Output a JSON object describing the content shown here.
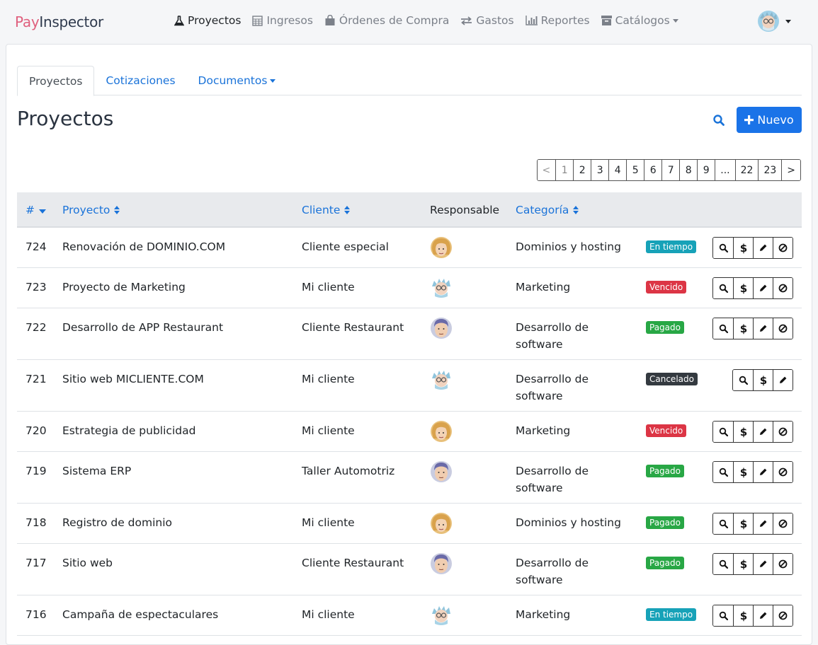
{
  "brand": {
    "part1": "Pay",
    "part2": "Inspector"
  },
  "nav": [
    {
      "label": "Proyectos",
      "icon": "flask-icon",
      "active": true
    },
    {
      "label": "Ingresos",
      "icon": "calculator-icon"
    },
    {
      "label": "Órdenes de Compra",
      "icon": "shopping-bag-icon"
    },
    {
      "label": "Gastos",
      "icon": "exchange-icon"
    },
    {
      "label": "Reportes",
      "icon": "bar-chart-icon"
    },
    {
      "label": "Catálogos",
      "icon": "archive-icon",
      "dropdown": true
    }
  ],
  "tabs": [
    {
      "label": "Proyectos",
      "active": true
    },
    {
      "label": "Cotizaciones"
    },
    {
      "label": "Documentos",
      "dropdown": true
    }
  ],
  "page": {
    "title": "Proyectos",
    "new_label": "Nuevo"
  },
  "pagination": [
    "<",
    "1",
    "2",
    "3",
    "4",
    "5",
    "6",
    "7",
    "8",
    "9",
    "...",
    "22",
    "23",
    ">"
  ],
  "columns": {
    "id": "#",
    "project": "Proyecto",
    "client": "Cliente",
    "responsible": "Responsable",
    "category": "Categoría"
  },
  "rows": [
    {
      "id": "724",
      "project": "Renovación de DOMINIO.COM",
      "client": "Cliente especial",
      "avatar": "blonde",
      "category": [
        "Dominios y hosting"
      ],
      "status": "En tiempo",
      "status_color": "#17a2b8",
      "cancel": true
    },
    {
      "id": "723",
      "project": "Proyecto de Marketing",
      "client": "Mi cliente",
      "avatar": "scientist",
      "category": [
        "Marketing"
      ],
      "status": "Vencido",
      "status_color": "#dc3545",
      "cancel": true
    },
    {
      "id": "722",
      "project": "Desarrollo de APP Restaurant",
      "client": "Cliente Restaurant",
      "avatar": "man",
      "category": [
        "Desarrollo de",
        "software"
      ],
      "status": "Pagado",
      "status_color": "#28a745",
      "cancel": true
    },
    {
      "id": "721",
      "project": "Sitio web MICLIENTE.COM",
      "client": "Mi cliente",
      "avatar": "scientist",
      "category": [
        "Desarrollo de",
        "software"
      ],
      "status": "Cancelado",
      "status_color": "#343a40",
      "cancel": false
    },
    {
      "id": "720",
      "project": "Estrategia de publicidad",
      "client": "Mi cliente",
      "avatar": "blonde",
      "category": [
        "Marketing"
      ],
      "status": "Vencido",
      "status_color": "#dc3545",
      "cancel": true
    },
    {
      "id": "719",
      "project": "Sistema ERP",
      "client": "Taller Automotriz",
      "avatar": "man",
      "category": [
        "Desarrollo de",
        "software"
      ],
      "status": "Pagado",
      "status_color": "#28a745",
      "cancel": true
    },
    {
      "id": "718",
      "project": "Registro de dominio",
      "client": "Mi cliente",
      "avatar": "blonde",
      "category": [
        "Dominios y hosting"
      ],
      "status": "Pagado",
      "status_color": "#28a745",
      "cancel": true
    },
    {
      "id": "717",
      "project": "Sitio web",
      "client": "Cliente Restaurant",
      "avatar": "man",
      "category": [
        "Desarrollo de",
        "software"
      ],
      "status": "Pagado",
      "status_color": "#28a745",
      "cancel": true
    },
    {
      "id": "716",
      "project": "Campaña de espectaculares",
      "client": "Mi cliente",
      "avatar": "scientist",
      "category": [
        "Marketing"
      ],
      "status": "En tiempo",
      "status_color": "#17a2b8",
      "cancel": true
    }
  ]
}
